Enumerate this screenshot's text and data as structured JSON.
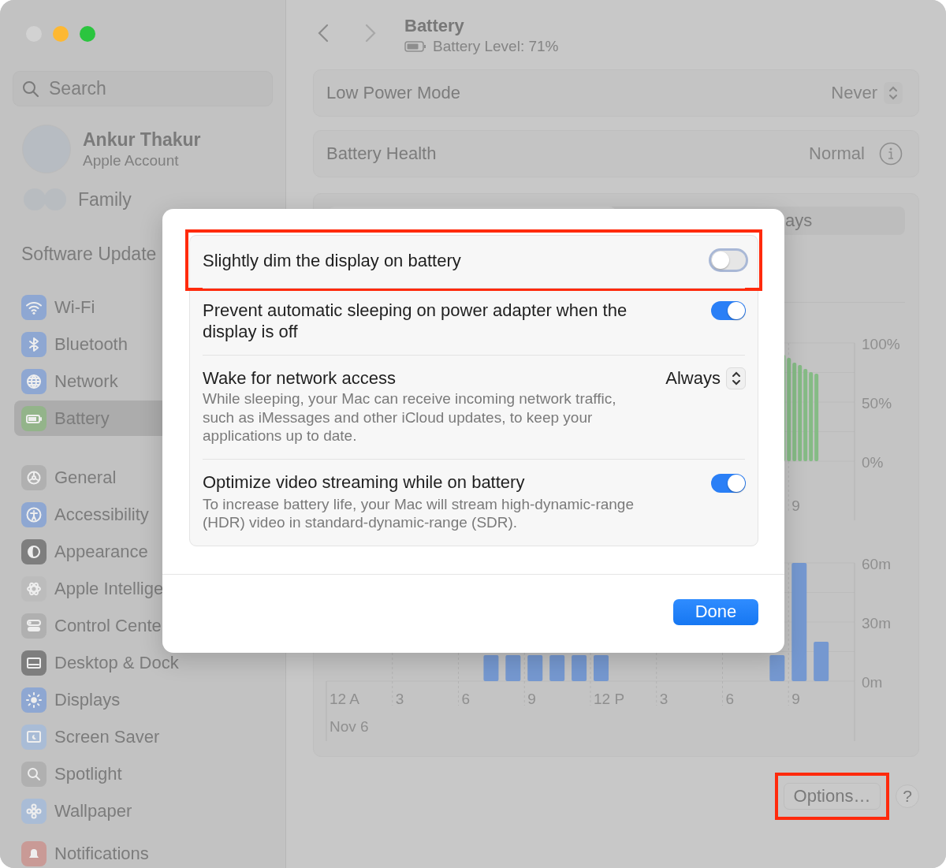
{
  "sidebar": {
    "search": {
      "placeholder": "Search"
    },
    "account": {
      "name": "Ankur Thakur",
      "subtitle": "Apple Account"
    },
    "family": {
      "label": "Family"
    },
    "notice": "Software Update",
    "groups": [
      {
        "items": [
          {
            "label": "Wi-Fi",
            "selected": false,
            "color": "#8ea7d2"
          },
          {
            "label": "Bluetooth",
            "selected": false,
            "color": "#8ea7d2"
          },
          {
            "label": "Network",
            "selected": false,
            "color": "#8ea7d2"
          },
          {
            "label": "Battery",
            "selected": true,
            "color": "#93b48a"
          }
        ]
      },
      {
        "items": [
          {
            "label": "General",
            "selected": false,
            "color": "#b0b0b0"
          },
          {
            "label": "Accessibility",
            "selected": false,
            "color": "#8ea7d2"
          },
          {
            "label": "Appearance",
            "selected": false,
            "color": "#7e7e7e"
          },
          {
            "label": "Apple Intellige",
            "selected": false,
            "color": "#bcbcbc"
          },
          {
            "label": "Control Cente",
            "selected": false,
            "color": "#b0b0b0"
          },
          {
            "label": "Desktop & Dock",
            "selected": false,
            "color": "#7e7e7e"
          },
          {
            "label": "Displays",
            "selected": false,
            "color": "#8ea7d2"
          },
          {
            "label": "Screen Saver",
            "selected": false,
            "color": "#a9bcd6"
          },
          {
            "label": "Spotlight",
            "selected": false,
            "color": "#b0b0b0"
          },
          {
            "label": "Wallpaper",
            "selected": false,
            "color": "#a9bcd6"
          }
        ]
      },
      {
        "items": [
          {
            "label": "Notifications",
            "selected": false,
            "color": "#c99a96"
          }
        ]
      }
    ]
  },
  "header": {
    "title": "Battery",
    "subtitle": "Battery Level: 71%"
  },
  "settings": [
    {
      "kind": "popup",
      "label": "Low Power Mode",
      "value": "Never"
    },
    {
      "kind": "info",
      "label": "Battery Health",
      "value": "Normal"
    }
  ],
  "usage": {
    "segment_label": "ays",
    "level_chart": {
      "y_labels": [
        "100%",
        "50%",
        "0%"
      ],
      "x_labels": [
        "9"
      ]
    },
    "activity_chart": {
      "y_labels": [
        "60m",
        "30m",
        "0m"
      ],
      "x_labels": [
        "12 A",
        "3",
        "6",
        "9",
        "12 P",
        "3",
        "6",
        "9"
      ],
      "date_label": "Nov 6"
    }
  },
  "options_button": {
    "label": "Options…",
    "highlighted": true
  },
  "help_button": {
    "label": "?"
  },
  "sheet": {
    "rows": [
      {
        "kind": "toggle",
        "title": "Slightly dim the display on battery",
        "on": false,
        "highlighted": true
      },
      {
        "kind": "toggle",
        "title": "Prevent automatic sleeping on power adapter when the display is off",
        "on": true,
        "highlighted": false
      },
      {
        "kind": "popup",
        "title": "Wake for network access",
        "value": "Always",
        "description": "While sleeping, your Mac can receive incoming network traffic, such as iMessages and other iCloud updates, to keep your applications up to date.",
        "highlighted": false
      },
      {
        "kind": "toggle",
        "title": "Optimize video streaming while on battery",
        "on": true,
        "description": "To increase battery life, your Mac will stream high-dynamic-range (HDR) video in standard-dynamic-range (SDR).",
        "highlighted": false
      }
    ],
    "done_button": "Done"
  }
}
